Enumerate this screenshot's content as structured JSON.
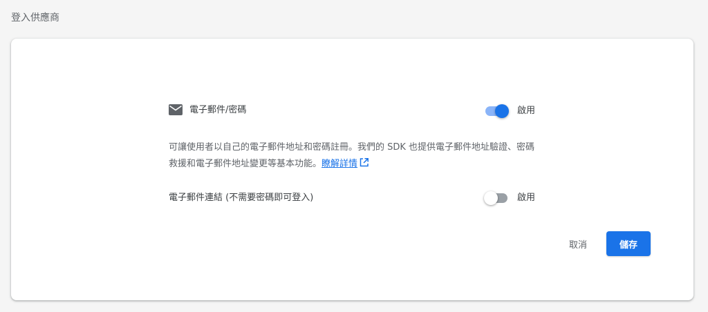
{
  "page": {
    "title": "登入供應商"
  },
  "provider": {
    "icon": "mail-icon",
    "label": "電子郵件/密碼",
    "enabled": true,
    "enable_label": "啟用"
  },
  "description": {
    "text": "可讓使用者以自己的電子郵件地址和密碼註冊。我們的 SDK 也提供電子郵件地址驗證、密碼救援和電子郵件地址變更等基本功能。",
    "learn_more": "瞭解詳情",
    "learn_more_icon": "open-in-new-icon"
  },
  "email_link": {
    "label": "電子郵件連結 (不需要密碼即可登入)",
    "enabled": false,
    "enable_label": "啟用"
  },
  "actions": {
    "cancel_label": "取消",
    "save_label": "儲存"
  },
  "colors": {
    "accent": "#1a73e8",
    "accent_track": "#8ab4f8",
    "off_track": "#9aa0a6"
  }
}
